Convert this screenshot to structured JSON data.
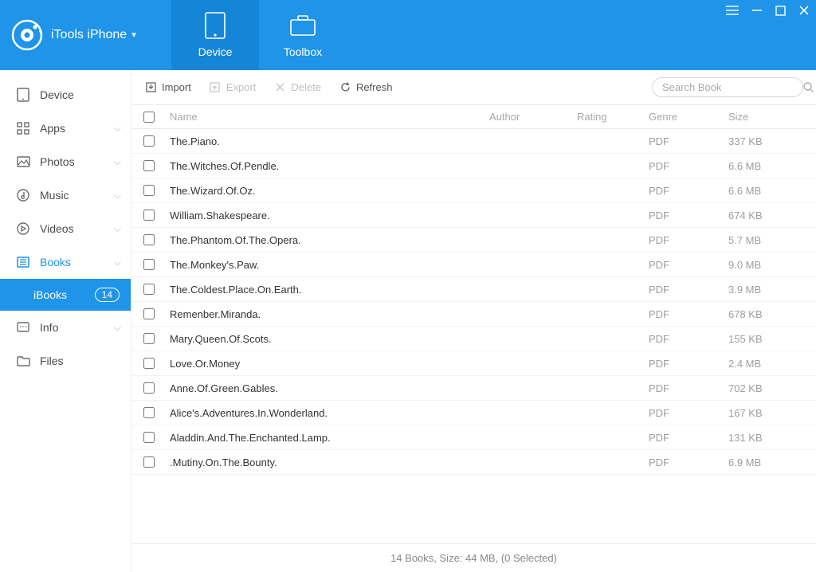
{
  "app_title": "iTools iPhone",
  "header_tabs": {
    "device": "Device",
    "toolbox": "Toolbox"
  },
  "sidebar": {
    "items": [
      {
        "label": "Device",
        "icon": "device"
      },
      {
        "label": "Apps",
        "icon": "apps"
      },
      {
        "label": "Photos",
        "icon": "photos"
      },
      {
        "label": "Music",
        "icon": "music"
      },
      {
        "label": "Videos",
        "icon": "videos"
      },
      {
        "label": "Books",
        "icon": "books"
      },
      {
        "label": "Info",
        "icon": "info"
      },
      {
        "label": "Files",
        "icon": "files"
      }
    ],
    "sub": {
      "label": "iBooks",
      "count": "14"
    }
  },
  "toolbar": {
    "import": "Import",
    "export": "Export",
    "delete": "Delete",
    "refresh": "Refresh",
    "search_placeholder": "Search Book"
  },
  "columns": {
    "name": "Name",
    "author": "Author",
    "rating": "Rating",
    "genre": "Genre",
    "size": "Size"
  },
  "books": [
    {
      "name": "The.Piano.",
      "genre": "PDF",
      "size": "337 KB"
    },
    {
      "name": "The.Witches.Of.Pendle.",
      "genre": "PDF",
      "size": "6.6 MB"
    },
    {
      "name": "The.Wizard.Of.Oz.",
      "genre": "PDF",
      "size": "6.6 MB"
    },
    {
      "name": "William.Shakespeare.",
      "genre": "PDF",
      "size": "674 KB"
    },
    {
      "name": "The.Phantom.Of.The.Opera.",
      "genre": "PDF",
      "size": "5.7 MB"
    },
    {
      "name": "The.Monkey's.Paw.",
      "genre": "PDF",
      "size": "9.0 MB"
    },
    {
      "name": "The.Coldest.Place.On.Earth.",
      "genre": "PDF",
      "size": "3.9 MB"
    },
    {
      "name": "Remenber.Miranda.",
      "genre": "PDF",
      "size": "678 KB"
    },
    {
      "name": "Mary.Queen.Of.Scots.",
      "genre": "PDF",
      "size": "155 KB"
    },
    {
      "name": "Love.Or.Money",
      "genre": "PDF",
      "size": "2.4 MB"
    },
    {
      "name": "Anne.Of.Green.Gables.",
      "genre": "PDF",
      "size": "702 KB"
    },
    {
      "name": "Alice's.Adventures.In.Wonderland.",
      "genre": "PDF",
      "size": "167 KB"
    },
    {
      "name": "Aladdin.And.The.Enchanted.Lamp.",
      "genre": "PDF",
      "size": "131 KB"
    },
    {
      "name": ".Mutiny.On.The.Bounty.",
      "genre": "PDF",
      "size": "6.9 MB"
    }
  ],
  "status": "14 Books, Size: 44 MB, (0 Selected)"
}
